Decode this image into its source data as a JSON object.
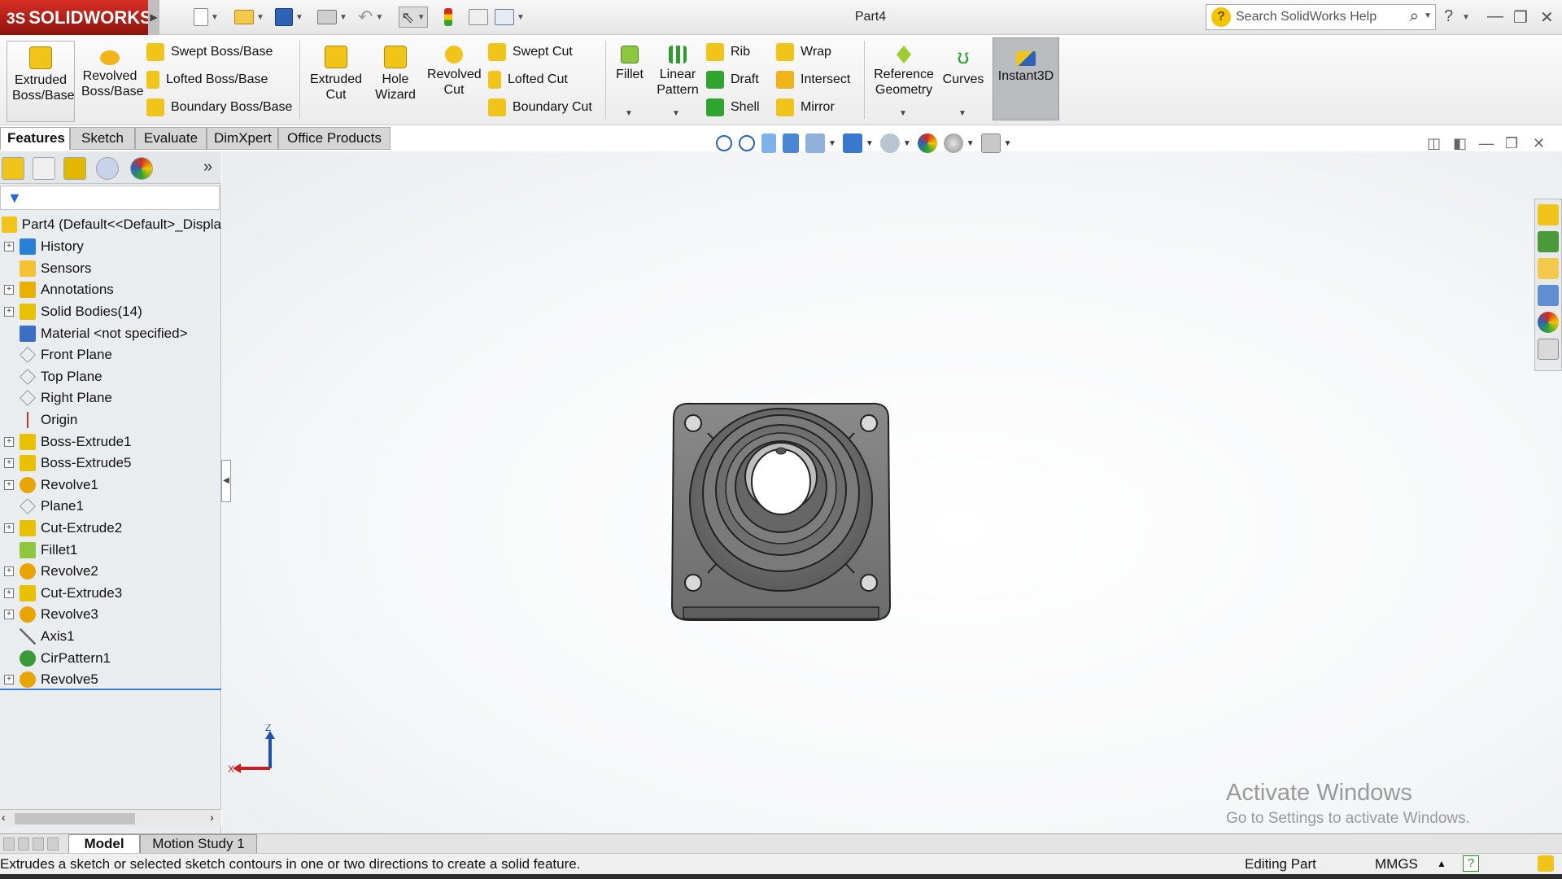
{
  "app": {
    "name": "SOLIDWORKS",
    "brand_prefix": "3S",
    "document_title": "Part4"
  },
  "search": {
    "placeholder": "Search SolidWorks Help"
  },
  "ribbon": {
    "extruded_boss": "Extruded Boss/Base",
    "revolved_boss": "Revolved Boss/Base",
    "swept_boss": "Swept Boss/Base",
    "lofted_boss": "Lofted Boss/Base",
    "boundary_boss": "Boundary Boss/Base",
    "extruded_cut": "Extruded Cut",
    "hole_wizard": "Hole Wizard",
    "revolved_cut": "Revolved Cut",
    "swept_cut": "Swept Cut",
    "lofted_cut": "Lofted Cut",
    "boundary_cut": "Boundary Cut",
    "fillet": "Fillet",
    "linear_pattern": "Linear Pattern",
    "rib": "Rib",
    "draft": "Draft",
    "shell": "Shell",
    "wrap": "Wrap",
    "intersect": "Intersect",
    "mirror": "Mirror",
    "reference_geometry": "Reference Geometry",
    "curves": "Curves",
    "instant3d": "Instant3D"
  },
  "tabs": [
    "Features",
    "Sketch",
    "Evaluate",
    "DimXpert",
    "Office Products"
  ],
  "tree": {
    "root": "Part4  (Default<<Default>_Displa",
    "items": [
      {
        "label": "History",
        "expandable": true,
        "icon": "history-icon",
        "color": "#2a7fd6"
      },
      {
        "label": "Sensors",
        "expandable": false,
        "icon": "sensors-icon",
        "color": "#f1c232"
      },
      {
        "label": "Annotations",
        "expandable": true,
        "icon": "annotations-icon",
        "color": "#e8b100"
      },
      {
        "label": "Solid Bodies(14)",
        "expandable": true,
        "icon": "solid-bodies-icon",
        "color": "#e8c200"
      },
      {
        "label": "Material <not specified>",
        "expandable": false,
        "icon": "material-icon",
        "color": "#3a6fc4"
      },
      {
        "label": "Front Plane",
        "expandable": false,
        "icon": "plane-icon",
        "color": "#777777"
      },
      {
        "label": "Top Plane",
        "expandable": false,
        "icon": "plane-icon",
        "color": "#777777"
      },
      {
        "label": "Right Plane",
        "expandable": false,
        "icon": "plane-icon",
        "color": "#777777"
      },
      {
        "label": "Origin",
        "expandable": false,
        "icon": "origin-icon",
        "color": "#c0392b"
      },
      {
        "label": "Boss-Extrude1",
        "expandable": true,
        "icon": "extrude-icon",
        "color": "#e8c200"
      },
      {
        "label": "Boss-Extrude5",
        "expandable": true,
        "icon": "extrude-icon",
        "color": "#e8c200"
      },
      {
        "label": "Revolve1",
        "expandable": true,
        "icon": "revolve-icon",
        "color": "#e8a500"
      },
      {
        "label": "Plane1",
        "expandable": false,
        "icon": "plane-icon",
        "color": "#777777"
      },
      {
        "label": "Cut-Extrude2",
        "expandable": true,
        "icon": "cut-extrude-icon",
        "color": "#e8c200"
      },
      {
        "label": "Fillet1",
        "expandable": false,
        "icon": "fillet-icon",
        "color": "#8dc63f"
      },
      {
        "label": "Revolve2",
        "expandable": true,
        "icon": "revolve-icon",
        "color": "#e8a500"
      },
      {
        "label": "Cut-Extrude3",
        "expandable": true,
        "icon": "cut-extrude-icon",
        "color": "#e8c200"
      },
      {
        "label": "Revolve3",
        "expandable": true,
        "icon": "revolve-icon",
        "color": "#e8a500"
      },
      {
        "label": "Axis1",
        "expandable": false,
        "icon": "axis-icon",
        "color": "#666666"
      },
      {
        "label": "CirPattern1",
        "expandable": false,
        "icon": "circular-pattern-icon",
        "color": "#3a9a3a"
      },
      {
        "label": "Revolve5",
        "expandable": true,
        "icon": "revolve-icon",
        "color": "#e8a500"
      }
    ]
  },
  "triad": {
    "z": "Z",
    "x": "X"
  },
  "watermark": {
    "line1": "Activate Windows",
    "line2": "Go to Settings to activate Windows."
  },
  "bottom_tabs": [
    "Model",
    "Motion Study 1"
  ],
  "status": {
    "message": "Extrudes a sketch or selected sketch contours in one or two directions to create a solid feature.",
    "mode": "Editing Part",
    "units": "MMGS"
  },
  "colors": {
    "brand_red": "#c8241a",
    "selection_blue": "#3d7fd6",
    "part_gray": "#7a7a7a"
  }
}
